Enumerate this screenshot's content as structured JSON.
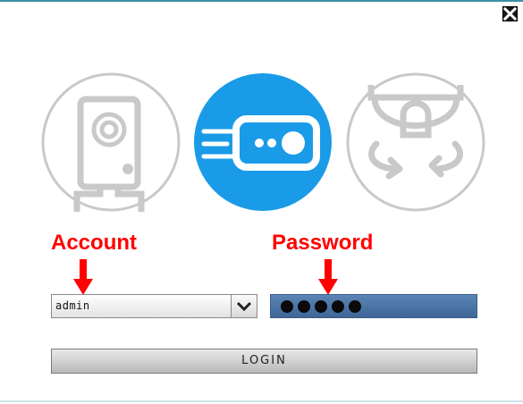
{
  "annotations": {
    "account": "Account",
    "password": "Password"
  },
  "account_select": {
    "selected_value": "admin",
    "options": [
      "admin"
    ]
  },
  "password_field": {
    "masked_length": 5
  },
  "login_button": {
    "label": "LOGIN"
  },
  "icons": {
    "close": "close-icon",
    "camera": "cube-camera-icon",
    "nvr": "network-video-recorder-icon",
    "dome": "ptz-dome-camera-icon"
  },
  "colors": {
    "accent_blue": "#1a9be8",
    "annotation_red": "#ff0000",
    "icon_gray": "#c9c9c9",
    "password_field": "#4a74a6"
  }
}
